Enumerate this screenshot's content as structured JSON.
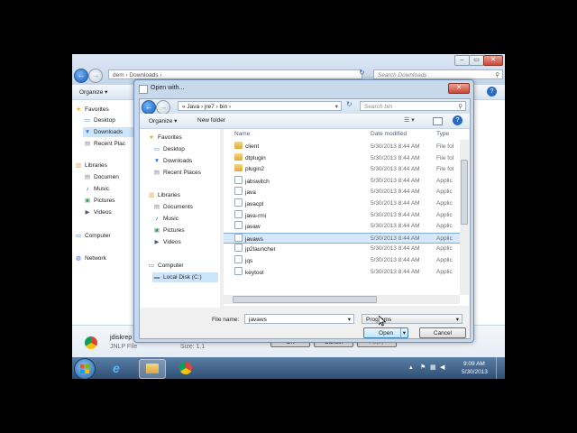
{
  "explorer": {
    "breadcrumb": "dem  ›  Downloads  ›",
    "search_placeholder": "Search Downloads",
    "organize_label": "Organize ▾",
    "nav": [
      {
        "label": "Favorites",
        "icon": "star-icon"
      },
      {
        "label": "Desktop",
        "icon": "desktop-icon"
      },
      {
        "label": "Downloads",
        "icon": "downloads-icon"
      },
      {
        "label": "Recent Plac",
        "icon": "recent-places-icon"
      },
      {
        "label": "Libraries",
        "icon": "libraries-icon"
      },
      {
        "label": "Documen",
        "icon": "documents-icon"
      },
      {
        "label": "Music",
        "icon": "music-icon"
      },
      {
        "label": "Pictures",
        "icon": "pictures-icon"
      },
      {
        "label": "Videos",
        "icon": "videos-icon"
      },
      {
        "label": "Computer",
        "icon": "computer-icon"
      },
      {
        "label": "Network",
        "icon": "network-icon"
      }
    ],
    "detail_name": "jdiskrep",
    "detail_type": "JNLP File",
    "detail_size": "Size: 1.1",
    "ok_label": "OK",
    "cancel_label": "Cancel",
    "apply_label": "Apply"
  },
  "dialog": {
    "title": "Open with...",
    "breadcrumb": "«  Java  ›  jre7  ›  bin  ›",
    "search_placeholder": "Search bin",
    "organize_label": "Organize ▾",
    "new_folder_label": "New folder",
    "nav": [
      {
        "label": "Favorites",
        "icon": "star-icon",
        "indent": 0
      },
      {
        "label": "Desktop",
        "icon": "desktop-icon",
        "indent": 1
      },
      {
        "label": "Downloads",
        "icon": "downloads-icon",
        "indent": 1
      },
      {
        "label": "Recent Places",
        "icon": "recent-places-icon",
        "indent": 1
      },
      {
        "label": "Libraries",
        "icon": "libraries-icon",
        "indent": 0
      },
      {
        "label": "Documents",
        "icon": "documents-icon",
        "indent": 1
      },
      {
        "label": "Music",
        "icon": "music-icon",
        "indent": 1
      },
      {
        "label": "Pictures",
        "icon": "pictures-icon",
        "indent": 1
      },
      {
        "label": "Videos",
        "icon": "videos-icon",
        "indent": 1
      },
      {
        "label": "Computer",
        "icon": "computer-icon",
        "indent": 0
      },
      {
        "label": "Local Disk (C:)",
        "icon": "local-disk-icon",
        "indent": 1
      }
    ],
    "columns": {
      "name": "Name",
      "date": "Date modified",
      "type": "Type"
    },
    "files": [
      {
        "name": "client",
        "date": "5/30/2013 8:44 AM",
        "type": "File fol",
        "kind": "folder"
      },
      {
        "name": "dtplugin",
        "date": "5/30/2013 8:44 AM",
        "type": "File fol",
        "kind": "folder"
      },
      {
        "name": "plugin2",
        "date": "5/30/2013 8:44 AM",
        "type": "File fol",
        "kind": "folder"
      },
      {
        "name": "jabswitch",
        "date": "5/30/2013 8:44 AM",
        "type": "Applic",
        "kind": "app"
      },
      {
        "name": "java",
        "date": "5/30/2013 8:44 AM",
        "type": "Applic",
        "kind": "app"
      },
      {
        "name": "javacpl",
        "date": "5/30/2013 8:44 AM",
        "type": "Applic",
        "kind": "app"
      },
      {
        "name": "java-rmi",
        "date": "5/30/2013 8:44 AM",
        "type": "Applic",
        "kind": "app"
      },
      {
        "name": "javaw",
        "date": "5/30/2013 8:44 AM",
        "type": "Applic",
        "kind": "app"
      },
      {
        "name": "javaws",
        "date": "5/30/2013 8:44 AM",
        "type": "Applic",
        "kind": "app",
        "selected": true
      },
      {
        "name": "jp2launcher",
        "date": "5/30/2013 8:44 AM",
        "type": "Applic",
        "kind": "app"
      },
      {
        "name": "jqs",
        "date": "5/30/2013 8:44 AM",
        "type": "Applic",
        "kind": "app"
      },
      {
        "name": "keytool",
        "date": "5/30/2013 8:44 AM",
        "type": "Applic",
        "kind": "app"
      }
    ],
    "file_name_label": "File name:",
    "file_name_value": "javaws",
    "filter_value": "Programs",
    "open_label": "Open",
    "cancel_label": "Cancel"
  },
  "taskbar": {
    "time": "9:09 AM",
    "date": "5/30/2013"
  }
}
